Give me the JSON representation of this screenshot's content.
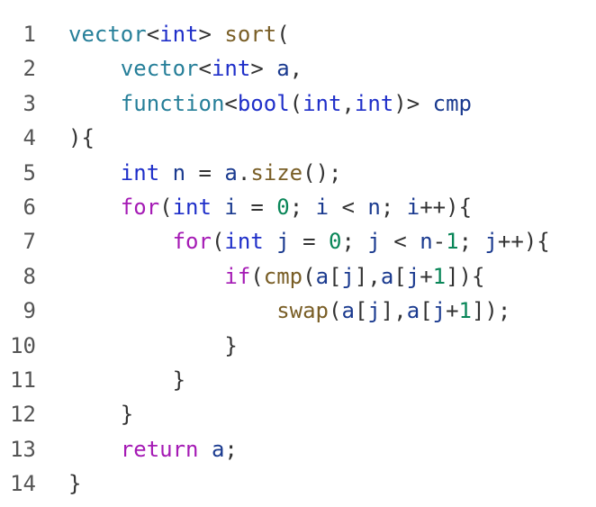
{
  "editor": {
    "lines": [
      {
        "number": "1",
        "indent": "",
        "tokens": [
          {
            "t": "vector",
            "k": "type"
          },
          {
            "t": "<",
            "k": "punct"
          },
          {
            "t": "int",
            "k": "kw"
          },
          {
            "t": "> ",
            "k": "punct"
          },
          {
            "t": "sort",
            "k": "fn"
          },
          {
            "t": "(",
            "k": "punct"
          }
        ]
      },
      {
        "number": "2",
        "indent": "    ",
        "tokens": [
          {
            "t": "vector",
            "k": "type"
          },
          {
            "t": "<",
            "k": "punct"
          },
          {
            "t": "int",
            "k": "kw"
          },
          {
            "t": "> ",
            "k": "punct"
          },
          {
            "t": "a",
            "k": "var"
          },
          {
            "t": ",",
            "k": "punct"
          }
        ]
      },
      {
        "number": "3",
        "indent": "    ",
        "tokens": [
          {
            "t": "function",
            "k": "type"
          },
          {
            "t": "<",
            "k": "punct"
          },
          {
            "t": "bool",
            "k": "kw"
          },
          {
            "t": "(",
            "k": "punct"
          },
          {
            "t": "int",
            "k": "kw"
          },
          {
            "t": ",",
            "k": "punct"
          },
          {
            "t": "int",
            "k": "kw"
          },
          {
            "t": ")> ",
            "k": "punct"
          },
          {
            "t": "cmp",
            "k": "var"
          }
        ]
      },
      {
        "number": "4",
        "indent": "",
        "tokens": [
          {
            "t": "){",
            "k": "punct"
          }
        ]
      },
      {
        "number": "5",
        "indent": "    ",
        "tokens": [
          {
            "t": "int",
            "k": "kw"
          },
          {
            "t": " ",
            "k": "plain"
          },
          {
            "t": "n",
            "k": "var"
          },
          {
            "t": " = ",
            "k": "op"
          },
          {
            "t": "a",
            "k": "var"
          },
          {
            "t": ".",
            "k": "punct"
          },
          {
            "t": "size",
            "k": "fn"
          },
          {
            "t": "();",
            "k": "punct"
          }
        ]
      },
      {
        "number": "6",
        "indent": "    ",
        "tokens": [
          {
            "t": "for",
            "k": "ctrl"
          },
          {
            "t": "(",
            "k": "punct"
          },
          {
            "t": "int",
            "k": "kw"
          },
          {
            "t": " ",
            "k": "plain"
          },
          {
            "t": "i",
            "k": "var"
          },
          {
            "t": " = ",
            "k": "op"
          },
          {
            "t": "0",
            "k": "num"
          },
          {
            "t": "; ",
            "k": "punct"
          },
          {
            "t": "i",
            "k": "var"
          },
          {
            "t": " < ",
            "k": "op"
          },
          {
            "t": "n",
            "k": "var"
          },
          {
            "t": "; ",
            "k": "punct"
          },
          {
            "t": "i",
            "k": "var"
          },
          {
            "t": "++){",
            "k": "punct"
          }
        ]
      },
      {
        "number": "7",
        "indent": "        ",
        "tokens": [
          {
            "t": "for",
            "k": "ctrl"
          },
          {
            "t": "(",
            "k": "punct"
          },
          {
            "t": "int",
            "k": "kw"
          },
          {
            "t": " ",
            "k": "plain"
          },
          {
            "t": "j",
            "k": "var"
          },
          {
            "t": " = ",
            "k": "op"
          },
          {
            "t": "0",
            "k": "num"
          },
          {
            "t": "; ",
            "k": "punct"
          },
          {
            "t": "j",
            "k": "var"
          },
          {
            "t": " < ",
            "k": "op"
          },
          {
            "t": "n",
            "k": "var"
          },
          {
            "t": "-",
            "k": "op"
          },
          {
            "t": "1",
            "k": "num"
          },
          {
            "t": "; ",
            "k": "punct"
          },
          {
            "t": "j",
            "k": "var"
          },
          {
            "t": "++){",
            "k": "punct"
          }
        ]
      },
      {
        "number": "8",
        "indent": "            ",
        "tokens": [
          {
            "t": "if",
            "k": "ctrl"
          },
          {
            "t": "(",
            "k": "punct"
          },
          {
            "t": "cmp",
            "k": "fn"
          },
          {
            "t": "(",
            "k": "punct"
          },
          {
            "t": "a",
            "k": "var"
          },
          {
            "t": "[",
            "k": "punct"
          },
          {
            "t": "j",
            "k": "var"
          },
          {
            "t": "],",
            "k": "punct"
          },
          {
            "t": "a",
            "k": "var"
          },
          {
            "t": "[",
            "k": "punct"
          },
          {
            "t": "j",
            "k": "var"
          },
          {
            "t": "+",
            "k": "op"
          },
          {
            "t": "1",
            "k": "num"
          },
          {
            "t": "]){",
            "k": "punct"
          }
        ]
      },
      {
        "number": "9",
        "indent": "                ",
        "tokens": [
          {
            "t": "swap",
            "k": "fn"
          },
          {
            "t": "(",
            "k": "punct"
          },
          {
            "t": "a",
            "k": "var"
          },
          {
            "t": "[",
            "k": "punct"
          },
          {
            "t": "j",
            "k": "var"
          },
          {
            "t": "],",
            "k": "punct"
          },
          {
            "t": "a",
            "k": "var"
          },
          {
            "t": "[",
            "k": "punct"
          },
          {
            "t": "j",
            "k": "var"
          },
          {
            "t": "+",
            "k": "op"
          },
          {
            "t": "1",
            "k": "num"
          },
          {
            "t": "]);",
            "k": "punct"
          }
        ]
      },
      {
        "number": "10",
        "indent": "            ",
        "tokens": [
          {
            "t": "}",
            "k": "punct"
          }
        ]
      },
      {
        "number": "11",
        "indent": "        ",
        "tokens": [
          {
            "t": "}",
            "k": "punct"
          }
        ]
      },
      {
        "number": "12",
        "indent": "    ",
        "tokens": [
          {
            "t": "}",
            "k": "punct"
          }
        ]
      },
      {
        "number": "13",
        "indent": "    ",
        "tokens": [
          {
            "t": "return",
            "k": "ctrl"
          },
          {
            "t": " ",
            "k": "plain"
          },
          {
            "t": "a",
            "k": "var"
          },
          {
            "t": ";",
            "k": "punct"
          }
        ]
      },
      {
        "number": "14",
        "indent": "",
        "tokens": [
          {
            "t": "}",
            "k": "punct"
          }
        ]
      }
    ]
  },
  "colors": {
    "background": "#ffffff",
    "line_number": "#555555",
    "keyword": "#1f2fc9",
    "control": "#a51bb5",
    "type": "#267f99",
    "function": "#795e26",
    "variable": "#1a3a8f",
    "number": "#098658",
    "punctuation": "#333333"
  }
}
